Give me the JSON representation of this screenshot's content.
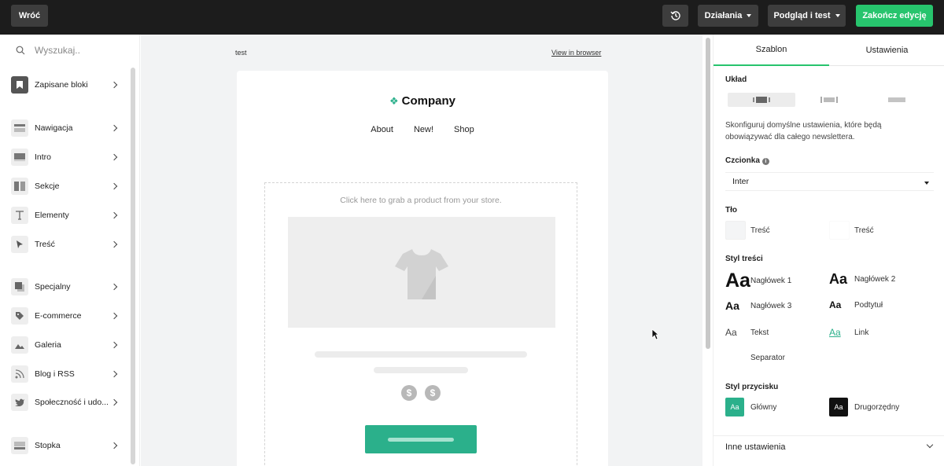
{
  "topbar": {
    "back_label": "Wróć",
    "history_icon": "history-icon",
    "actions_label": "Działania",
    "preview_label": "Podgląd i test",
    "finish_label": "Zakończ edycję",
    "accent_color": "#27c46d"
  },
  "sidebar": {
    "search_placeholder": "Wyszukaj..",
    "items": [
      {
        "label": "Zapisane bloki",
        "icon": "bookmark-icon"
      },
      {
        "label": "Nawigacja",
        "icon": "navigation-icon"
      },
      {
        "label": "Intro",
        "icon": "intro-icon"
      },
      {
        "label": "Sekcje",
        "icon": "sections-icon"
      },
      {
        "label": "Elementy",
        "icon": "text-icon"
      },
      {
        "label": "Treść",
        "icon": "cursor-icon"
      },
      {
        "label": "Specjalny",
        "icon": "special-icon"
      },
      {
        "label": "E-commerce",
        "icon": "tag-icon"
      },
      {
        "label": "Galeria",
        "icon": "image-icon"
      },
      {
        "label": "Blog i RSS",
        "icon": "rss-icon"
      },
      {
        "label": "Społeczność i udo...",
        "icon": "twitter-icon"
      },
      {
        "label": "Stopka",
        "icon": "footer-icon"
      }
    ]
  },
  "canvas": {
    "preheader": "test",
    "view_in_browser": "View in browser",
    "logo_text": "Company",
    "nav": [
      "About",
      "New!",
      "Shop"
    ],
    "product_hint": "Click here to grab a product from your store.",
    "price_symbol": "$"
  },
  "panel": {
    "tabs": [
      "Szablon",
      "Ustawienia"
    ],
    "active_tab": "Szablon",
    "layout_heading": "Układ",
    "layout_description": "Skonfiguruj domyślne ustawienia, które będą obowiązywać dla całego newslettera.",
    "font_heading": "Czcionka",
    "font_value": "Inter",
    "background_heading": "Tło",
    "background_items": [
      {
        "label": "Treść",
        "color": "#f4f5f6"
      },
      {
        "label": "Treść",
        "color": "#ffffff"
      }
    ],
    "content_style_heading": "Styl treści",
    "content_styles": [
      {
        "sample": "Aa",
        "label": "Nagłówek 1"
      },
      {
        "sample": "Aa",
        "label": "Nagłówek 2"
      },
      {
        "sample": "Aa",
        "label": "Nagłówek 3"
      },
      {
        "sample": "Aa",
        "label": "Podtytuł"
      },
      {
        "sample": "Aa",
        "label": "Tekst"
      },
      {
        "sample": "Aa",
        "label": "Link"
      },
      {
        "label": "Separator"
      }
    ],
    "button_style_heading": "Styl przycisku",
    "button_styles": [
      {
        "sample": "Aa",
        "label": "Główny",
        "color": "#2bb08b"
      },
      {
        "sample": "Aa",
        "label": "Drugorzędny",
        "color": "#111111"
      }
    ],
    "other_settings": "Inne ustawienia"
  }
}
